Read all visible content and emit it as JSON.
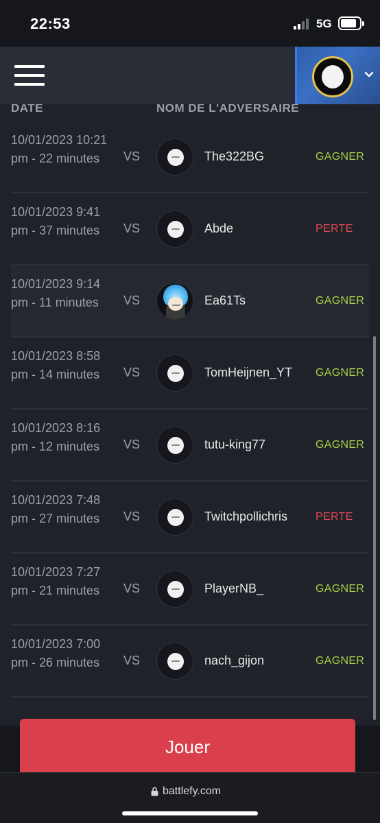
{
  "status_bar": {
    "time": "22:53",
    "network": "5G"
  },
  "header": {
    "menu_icon": "hamburger-icon",
    "dropdown_icon": "chevron-down-icon"
  },
  "table": {
    "columns": {
      "date": "DATE",
      "opponent": "NOM DE L'ADVERSAIRE"
    },
    "vs_label": "VS",
    "rows": [
      {
        "date": "10/01/2023 10:21 pm - 22 minutes",
        "opponent": "The322BG",
        "result": "GAGNER",
        "win": true
      },
      {
        "date": "10/01/2023 9:41 pm - 37 minutes",
        "opponent": "Abde",
        "result": "PERTE",
        "win": false
      },
      {
        "date": "10/01/2023 9:14 pm - 11 minutes",
        "opponent": "Ea61Ts",
        "result": "GAGNER",
        "win": true
      },
      {
        "date": "10/01/2023 8:58 pm - 14 minutes",
        "opponent": "TomHeijnen_YT",
        "result": "GAGNER",
        "win": true
      },
      {
        "date": "10/01/2023 8:16 pm - 12 minutes",
        "opponent": "tutu-king77",
        "result": "GAGNER",
        "win": true
      },
      {
        "date": "10/01/2023 7:48 pm - 27 minutes",
        "opponent": "Twitchpollichris",
        "result": "PERTE",
        "win": false
      },
      {
        "date": "10/01/2023 7:27 pm - 21 minutes",
        "opponent": "PlayerNB_",
        "result": "GAGNER",
        "win": true
      },
      {
        "date": "10/01/2023 7:00 pm - 26 minutes",
        "opponent": "nach_gijon",
        "result": "GAGNER",
        "win": true
      }
    ]
  },
  "play_button": {
    "label": "Jouer"
  },
  "browser": {
    "url": "battlefy.com"
  },
  "colors": {
    "win": "#a9d24a",
    "loss": "#e24a55",
    "accent": "#d9404b",
    "panel": "#1f2229"
  }
}
